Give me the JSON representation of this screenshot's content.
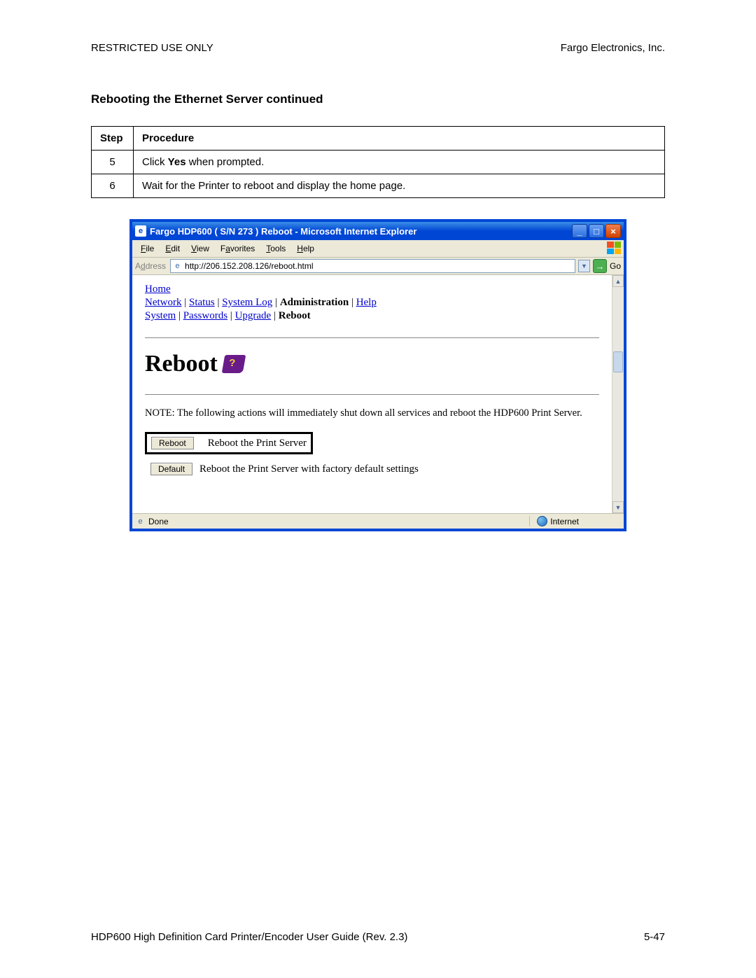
{
  "doc": {
    "header_left": "RESTRICTED USE ONLY",
    "header_right": "Fargo Electronics, Inc.",
    "section_title": "Rebooting the Ethernet Server  continued",
    "footer_left": "HDP600 High Definition Card Printer/Encoder User Guide (Rev. 2.3)",
    "footer_right": "5-47"
  },
  "table": {
    "col_step": "Step",
    "col_proc": "Procedure",
    "row1_step": "5",
    "row1_pre": "Click ",
    "row1_bold": "Yes",
    "row1_post": " when prompted.",
    "row2_step": "6",
    "row2_proc": "Wait for the Printer to reboot and display the home page."
  },
  "ie": {
    "title": "Fargo HDP600 ( S/N 273 ) Reboot - Microsoft Internet Explorer",
    "menu_file": "File",
    "menu_edit": "Edit",
    "menu_view": "View",
    "menu_fav": "Favorites",
    "menu_tools": "Tools",
    "menu_help": "Help",
    "addr_label": "Address",
    "addr_text": "http://206.152.208.126/reboot.html",
    "go_label": "Go",
    "status_left": "Done",
    "status_right": "Internet",
    "min": "_",
    "max": "□",
    "close": "×"
  },
  "content": {
    "home": "Home",
    "network": "Network",
    "status": "Status",
    "syslog": "System Log",
    "admin": "Administration",
    "help": "Help",
    "system": "System",
    "passwords": "Passwords",
    "upgrade": "Upgrade",
    "reboot_nav": "Reboot",
    "sep": " | ",
    "reboot_heading": "Reboot",
    "note": "NOTE: The following actions will immediately shut down all services and reboot the HDP600 Print Server.",
    "btn_reboot": "Reboot",
    "lbl_reboot": "Reboot the Print Server",
    "btn_default": "Default",
    "lbl_default": "Reboot the Print Server with factory default settings"
  }
}
